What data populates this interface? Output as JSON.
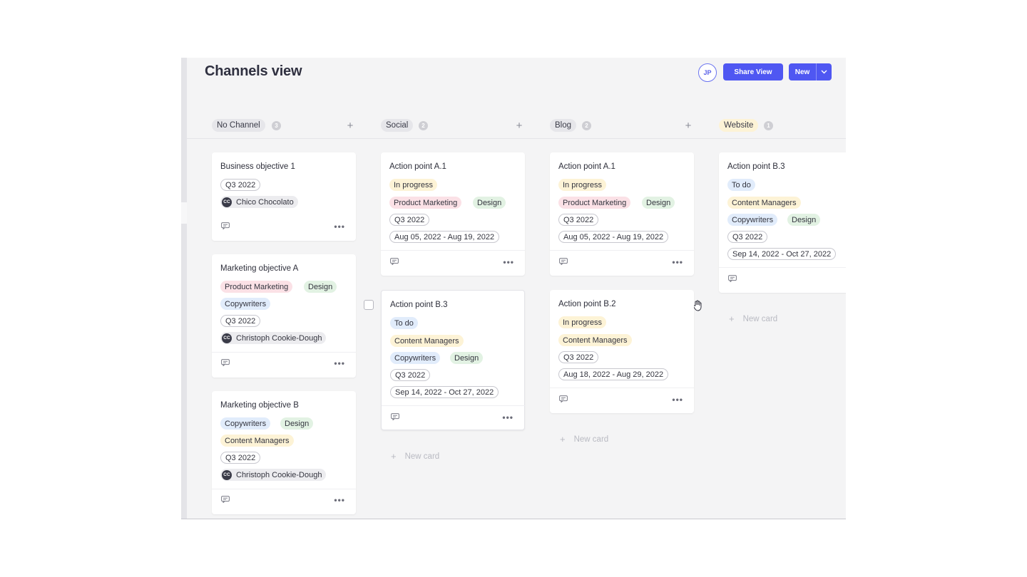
{
  "header": {
    "title": "Channels view",
    "avatar_initials": "JP",
    "share_label": "Share View",
    "new_label": "New"
  },
  "new_card_label": "New card",
  "columns": [
    {
      "name": "No Channel",
      "count": "3",
      "tag_color": "#e6e6ea",
      "cards": [
        {
          "title": "Business objective 1",
          "quarter": "Q3 2022",
          "owner_initials": "CC",
          "owner": "Chico Chocolato"
        },
        {
          "title": "Marketing objective A",
          "team1": "Product Marketing",
          "team2": "Design",
          "team3": "Copywriters",
          "quarter": "Q3 2022",
          "owner_initials": "CC",
          "owner": "Christoph Cookie-Dough"
        },
        {
          "title": "Marketing objective B",
          "team1": "Copywriters",
          "team2": "Design",
          "team3": "Content Managers",
          "quarter": "Q3 2022",
          "owner_initials": "CC",
          "owner": "Christoph Cookie-Dough"
        }
      ]
    },
    {
      "name": "Social",
      "count": "2",
      "tag_color": "#e6e6ea",
      "cards": [
        {
          "title": "Action point A.1",
          "status": "In progress",
          "team1": "Product Marketing",
          "team2": "Design",
          "quarter": "Q3 2022",
          "dates": "Aug 05, 2022 - Aug 19, 2022"
        },
        {
          "title": "Action point B.3",
          "status": "To do",
          "team1": "Content Managers",
          "team2": "Copywriters",
          "team3": "Design",
          "quarter": "Q3 2022",
          "dates": "Sep 14, 2022 - Oct 27, 2022"
        }
      ]
    },
    {
      "name": "Blog",
      "count": "2",
      "tag_color": "#e6e6ea",
      "cards": [
        {
          "title": "Action point A.1",
          "status": "In progress",
          "team1": "Product Marketing",
          "team2": "Design",
          "quarter": "Q3 2022",
          "dates": "Aug 05, 2022 - Aug 19, 2022"
        },
        {
          "title": "Action point B.2",
          "status": "In progress",
          "team1": "Content Managers",
          "quarter": "Q3 2022",
          "dates": "Aug 18, 2022 - Aug 29, 2022"
        }
      ]
    },
    {
      "name": "Website",
      "count": "1",
      "tag_color": "#fdf3d6",
      "cards": [
        {
          "title": "Action point B.3",
          "status": "To do",
          "team1": "Content Managers",
          "team2": "Copywriters",
          "team3": "Design",
          "quarter": "Q3 2022",
          "dates": "Sep 14, 2022 - Oct 27, 2022"
        }
      ]
    }
  ],
  "colors": {
    "accent": "#4f57f2",
    "status_in_progress": "#fdf3d6",
    "status_to_do": "#e1ecfb",
    "product_marketing": "#fbe1e6",
    "design": "#e2f2e3",
    "copywriters": "#e1ecfb",
    "content_managers": "#fdf3d6"
  }
}
